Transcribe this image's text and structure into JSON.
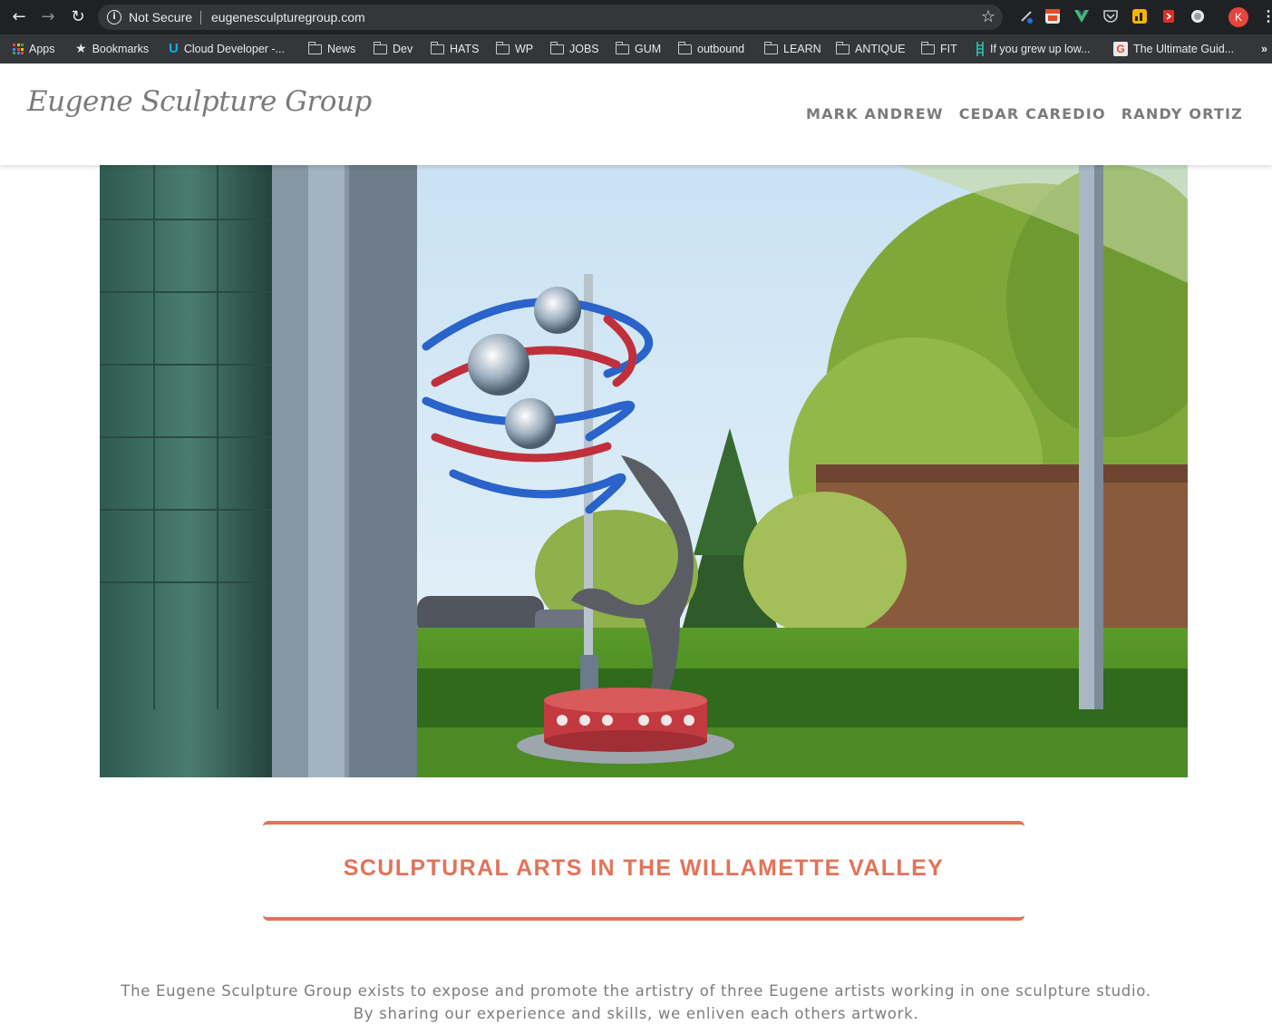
{
  "browser": {
    "security_label": "Not Secure",
    "url": "eugenesculpturegroup.com",
    "profile_initial": "K",
    "bookmarks": [
      {
        "label": "Apps",
        "icon": "apps-grid-icon"
      },
      {
        "label": "Bookmarks",
        "icon": "star-icon"
      },
      {
        "label": "Cloud Developer -...",
        "icon": "udacity-icon"
      },
      {
        "label": "News",
        "icon": "folder-icon"
      },
      {
        "label": "Dev",
        "icon": "folder-icon"
      },
      {
        "label": "HATS",
        "icon": "folder-icon"
      },
      {
        "label": "WP",
        "icon": "folder-icon"
      },
      {
        "label": "JOBS",
        "icon": "folder-icon"
      },
      {
        "label": "GUM",
        "icon": "folder-icon"
      },
      {
        "label": "outbound",
        "icon": "folder-icon"
      },
      {
        "label": "LEARN",
        "icon": "folder-icon"
      },
      {
        "label": "ANTIQUE",
        "icon": "folder-icon"
      },
      {
        "label": "FIT",
        "icon": "folder-icon"
      },
      {
        "label": "If you grew up low...",
        "icon": "ladder-icon"
      },
      {
        "label": "The Ultimate Guid...",
        "icon": "g-logo-icon"
      }
    ],
    "overflow_label": "»"
  },
  "site": {
    "logo": "Eugene Sculpture Group",
    "nav": [
      "MARK ANDREW",
      "CEDAR CAREDIO",
      "RANDY ORTIZ"
    ],
    "tagline": "SCULPTURAL ARTS IN THE WILLAMETTE VALLEY",
    "intro_line1": "The Eugene Sculpture Group exists to expose and promote the artistry of three Eugene artists working in one sculpture studio.",
    "intro_line2": "By sharing our experience and skills, we enliven each others artwork."
  },
  "colors": {
    "accent": "#e27359",
    "chrome_dark": "#202124",
    "chrome_bar": "#35363a",
    "text_gray": "#7d7d7d"
  }
}
